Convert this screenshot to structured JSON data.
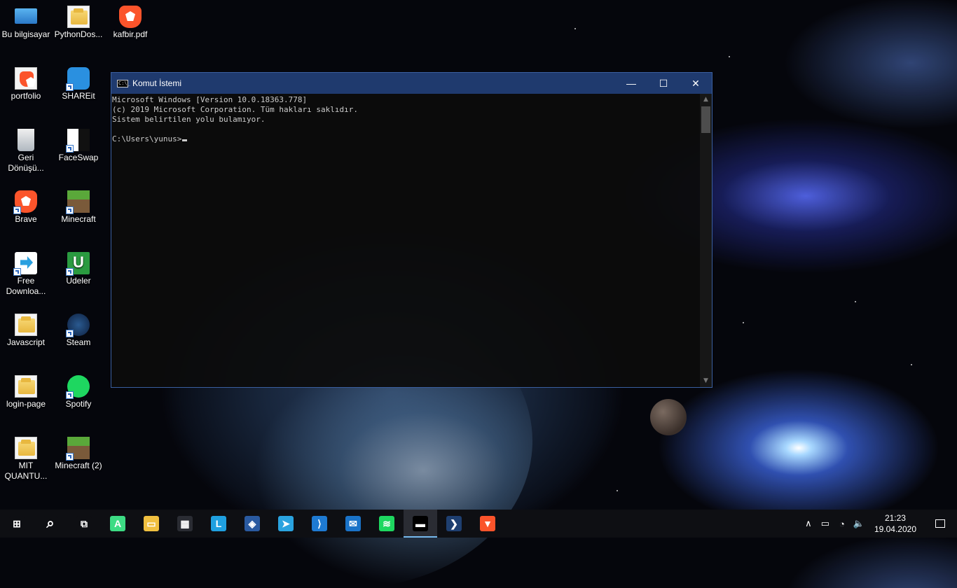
{
  "desktop": {
    "icons": [
      {
        "label": "Bu bilgisayar",
        "icon": "computer-icon"
      },
      {
        "label": "PythonDos...",
        "icon": "folder-icon"
      },
      {
        "label": "kafbir.pdf",
        "icon": "brave-pdf-icon"
      },
      {
        "label": "portfolio",
        "icon": "brave-html-icon"
      },
      {
        "label": "SHAREit",
        "icon": "shareit-icon"
      },
      {
        "label": "Geri\nDönüşü...",
        "icon": "recycle-bin-icon"
      },
      {
        "label": "FaceSwap",
        "icon": "faceswap-icon"
      },
      {
        "label": "Brave",
        "icon": "brave-icon"
      },
      {
        "label": "Minecraft",
        "icon": "minecraft-icon"
      },
      {
        "label": "Free\nDownloa...",
        "icon": "free-download-manager-icon"
      },
      {
        "label": "Udeler",
        "icon": "udeler-icon"
      },
      {
        "label": "Javascript",
        "icon": "folder-icon"
      },
      {
        "label": "Steam",
        "icon": "steam-icon"
      },
      {
        "label": "login-page",
        "icon": "folder-icon"
      },
      {
        "label": "Spotify",
        "icon": "spotify-icon"
      },
      {
        "label": "MIT\nQUANTU...",
        "icon": "folder-icon"
      },
      {
        "label": "Minecraft (2)",
        "icon": "minecraft-icon"
      }
    ]
  },
  "cmd": {
    "title": "Komut İstemi",
    "icon_text": "C:\\_",
    "minimize": "—",
    "maximize": "☐",
    "close": "✕",
    "lines": [
      "Microsoft Windows [Version 10.0.18363.778]",
      "(c) 2019 Microsoft Corporation. Tüm hakları saklıdır.",
      "Sistem belirtilen yolu bulamıyor.",
      "",
      "C:\\Users\\yunus>"
    ]
  },
  "taskbar": {
    "items": [
      {
        "name": "start-button",
        "glyph": "⊞",
        "color": "#0e0f13"
      },
      {
        "name": "search-button",
        "glyph": "⌕",
        "color": "#0e0f13"
      },
      {
        "name": "task-view-button",
        "glyph": "⧉",
        "color": "#0e0f13"
      },
      {
        "name": "android-studio-button",
        "glyph": "A",
        "color": "#3ddc84"
      },
      {
        "name": "file-explorer-button",
        "glyph": "▭",
        "color": "#f0c040"
      },
      {
        "name": "microsoft-store-button",
        "glyph": "▦",
        "color": "#2a2c33"
      },
      {
        "name": "l-app-button",
        "glyph": "L",
        "color": "#1fa0e0"
      },
      {
        "name": "virtualbox-button",
        "glyph": "◈",
        "color": "#2a5aa0"
      },
      {
        "name": "telegram-button",
        "glyph": "➤",
        "color": "#2aa3df"
      },
      {
        "name": "vscode-button",
        "glyph": "⟩",
        "color": "#1e7ad2"
      },
      {
        "name": "mail-button",
        "glyph": "✉",
        "color": "#1a73c8"
      },
      {
        "name": "spotify-button",
        "glyph": "≋",
        "color": "#1ed760"
      },
      {
        "name": "cmd-button",
        "glyph": "▬",
        "color": "#000000",
        "active": true
      },
      {
        "name": "powershell-button",
        "glyph": "❯",
        "color": "#1e3f70"
      },
      {
        "name": "brave-button",
        "glyph": "▼",
        "color": "#fb542b"
      }
    ],
    "tray": {
      "chevron": "∧",
      "time": "21:23",
      "date": "19.04.2020"
    }
  }
}
